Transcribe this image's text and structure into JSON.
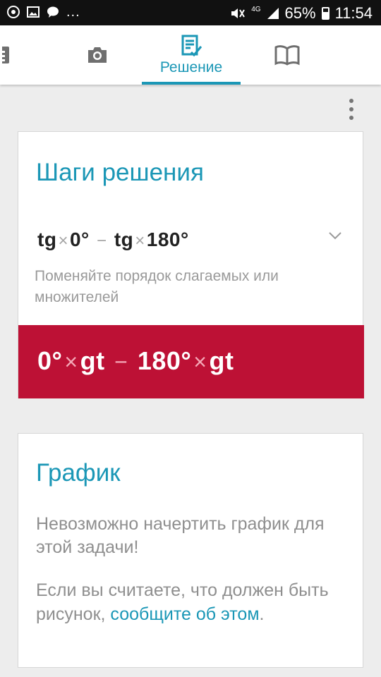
{
  "status_bar": {
    "left_icons": [
      "chrome-icon",
      "gallery-icon",
      "chat-icon"
    ],
    "dots": "...",
    "network": "4G",
    "battery": "65%",
    "time": "11:54"
  },
  "tabs": [
    {
      "id": "calculator",
      "icon": "calculator-icon"
    },
    {
      "id": "camera",
      "icon": "camera-icon"
    },
    {
      "id": "solution",
      "icon": "edit-note-icon",
      "label": "Решение",
      "active": true
    },
    {
      "id": "book",
      "icon": "book-icon"
    }
  ],
  "steps_card": {
    "title": "Шаги решения",
    "expression": {
      "t1": "tg",
      "op1": "×",
      "t2": "0°",
      "op2": "−",
      "t3": "tg",
      "op3": "×",
      "t4": "180°"
    },
    "hint": "Поменяйте порядок слагаемых или множителей",
    "result": {
      "t1": "0°",
      "op1": "×",
      "t2": "gt",
      "op2": "−",
      "t3": "180°",
      "op3": "×",
      "t4": "gt"
    }
  },
  "graph_card": {
    "title": "График",
    "message": "Невозможно начертить график для этой задачи!",
    "report_prefix": "Если вы считаете, что должен быть рисунок, ",
    "report_link": "сообщите об этом",
    "report_suffix": "."
  },
  "colors": {
    "accent": "#1b97b6",
    "result_bg": "#bd1135",
    "page_bg": "#ededed"
  }
}
